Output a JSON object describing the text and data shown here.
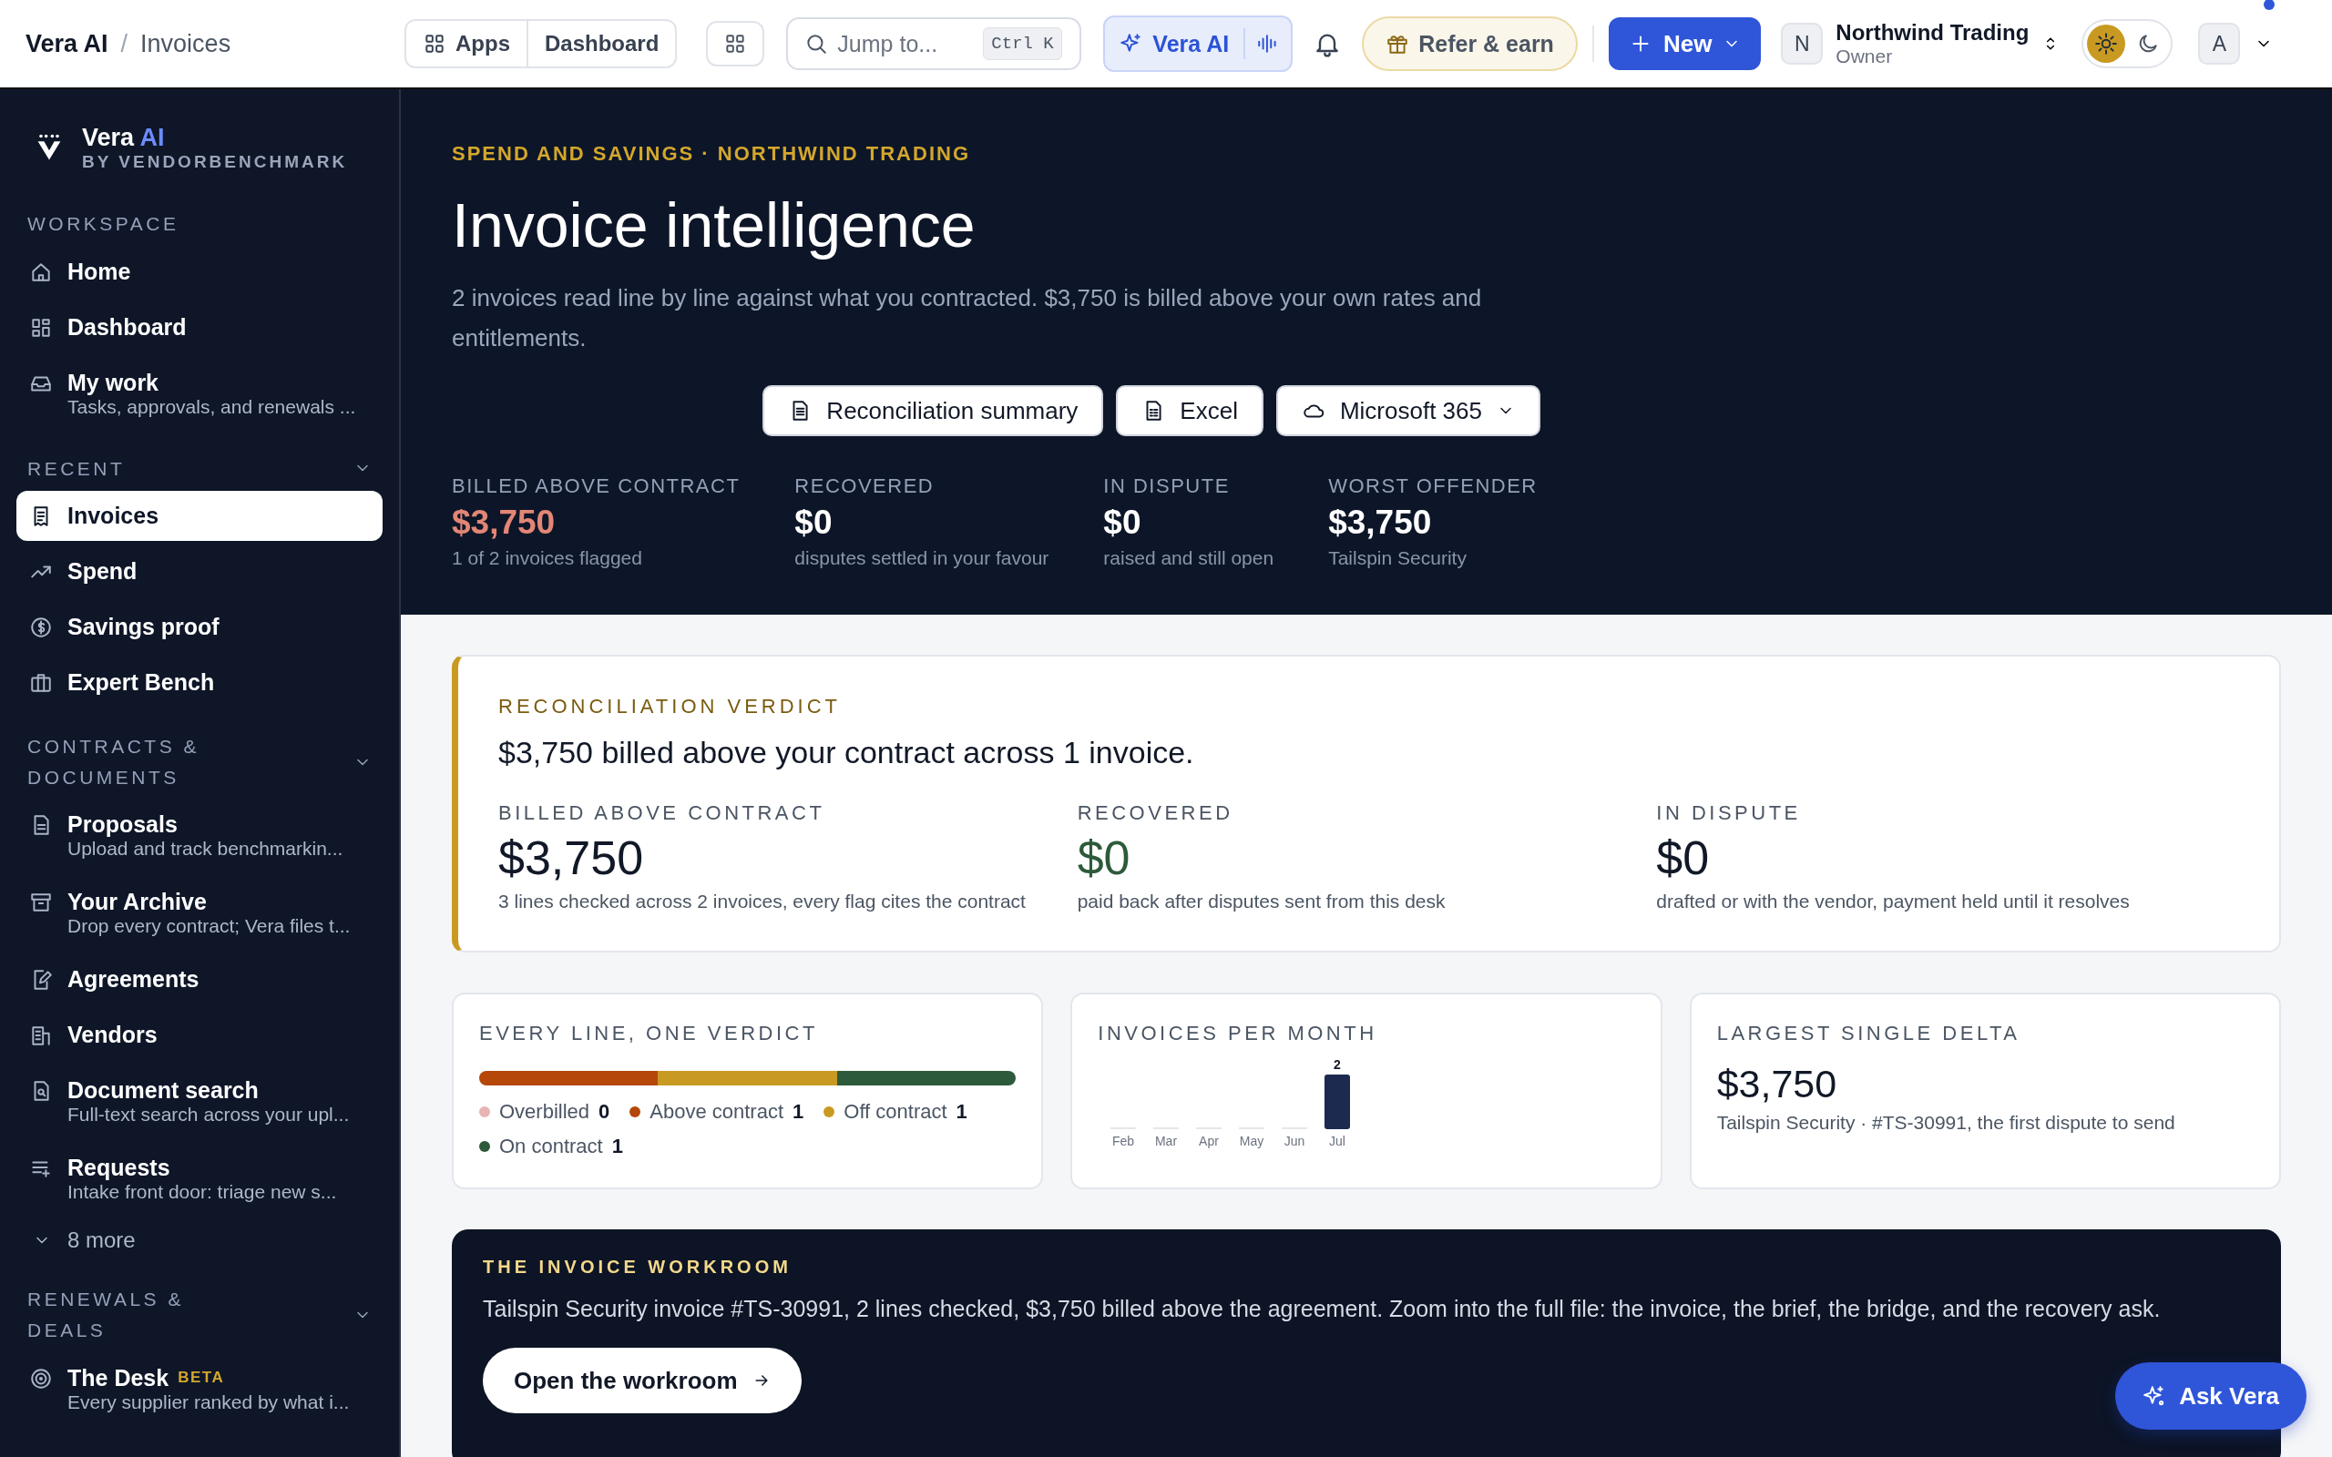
{
  "topbar": {
    "breadcrumb": {
      "items": [
        "Vera AI",
        "Invoices"
      ],
      "separator": "/"
    },
    "nav": [
      "Apps",
      "Dashboard"
    ],
    "search": {
      "placeholder": "Jump to...",
      "shortcut": "Ctrl K"
    },
    "assistant": "Vera AI",
    "refer": "Refer & earn",
    "new_button": "New",
    "org": {
      "initial": "N",
      "name": "Northwind Trading",
      "role": "Owner"
    },
    "theme": [
      {
        "kind": "light",
        "selected": true
      },
      {
        "kind": "dark",
        "selected": false
      }
    ],
    "user": {
      "initial": "A",
      "notification": true
    }
  },
  "sidebar": {
    "brand": {
      "name": "Vera",
      "accent": "AI",
      "by": "BY VENDORBENCHMARK"
    },
    "sections": [
      {
        "title": "WORKSPACE",
        "collapsible": false,
        "items": [
          {
            "label": "Home",
            "selected": false
          },
          {
            "label": "Dashboard",
            "selected": false
          },
          {
            "label": "My work",
            "sub": "Tasks, approvals, and renewals ...",
            "selected": false
          }
        ]
      },
      {
        "title": "RECENT",
        "collapsible": true,
        "items": [
          {
            "label": "Invoices",
            "selected": true
          },
          {
            "label": "Spend",
            "selected": false
          },
          {
            "label": "Savings proof",
            "selected": false
          },
          {
            "label": "Expert Bench",
            "selected": false
          }
        ]
      },
      {
        "title": "CONTRACTS & DOCUMENTS",
        "collapsible": true,
        "more": "8 more",
        "items": [
          {
            "label": "Proposals",
            "sub": "Upload and track benchmarkin...",
            "selected": false
          },
          {
            "label": "Your Archive",
            "sub": "Drop every contract; Vera files t...",
            "selected": false
          },
          {
            "label": "Agreements",
            "selected": false
          },
          {
            "label": "Vendors",
            "selected": false
          },
          {
            "label": "Document search",
            "sub": "Full-text search across your upl...",
            "selected": false
          },
          {
            "label": "Requests",
            "sub": "Intake front door: triage new s...",
            "selected": false
          }
        ]
      },
      {
        "title": "RENEWALS & DEALS",
        "collapsible": true,
        "items": [
          {
            "label": "The Desk",
            "badge": "BETA",
            "sub": "Every supplier ranked by what i...",
            "selected": false
          }
        ]
      }
    ]
  },
  "hero": {
    "eyebrow": "SPEND AND SAVINGS · NORTHWIND TRADING",
    "title": "Invoice intelligence",
    "description": "2 invoices read line by line against what you contracted. $3,750 is billed above your own rates and entitlements.",
    "actions": [
      {
        "label": "Reconciliation summary",
        "kind": "doc"
      },
      {
        "label": "Excel",
        "kind": "sheet"
      },
      {
        "label": "Microsoft 365",
        "kind": "cloud"
      }
    ],
    "stats": [
      {
        "label": "BILLED ABOVE CONTRACT",
        "value": "$3,750",
        "note": "1 of 2 invoices flagged",
        "color": "#e38676"
      },
      {
        "label": "RECOVERED",
        "value": "$0",
        "note": "disputes settled in your favour",
        "color": "#ffffff"
      },
      {
        "label": "IN DISPUTE",
        "value": "$0",
        "note": "raised and still open",
        "color": "#ffffff"
      },
      {
        "label": "WORST OFFENDER",
        "value": "$3,750",
        "note": "Tailspin Security",
        "color": "#ffffff"
      }
    ]
  },
  "verdict": {
    "eyebrow": "RECONCILIATION VERDICT",
    "headline": "$3,750 billed above your contract across 1 invoice.",
    "stats": [
      {
        "label": "BILLED ABOVE CONTRACT",
        "value": "$3,750",
        "note": "3 lines checked across 2 invoices, every flag cites the contract",
        "color": "#111827"
      },
      {
        "label": "RECOVERED",
        "value": "$0",
        "note": "paid back after disputes sent from this desk",
        "color": "#2d5a3a"
      },
      {
        "label": "IN DISPUTE",
        "value": "$0",
        "note": "drafted or with the vendor, payment held until it resolves",
        "color": "#111827"
      }
    ]
  },
  "line_verdict": {
    "title": "EVERY LINE, ONE VERDICT",
    "legend": [
      {
        "label": "Overbilled",
        "count": "0",
        "color": "#e8b4b4"
      },
      {
        "label": "Above contract",
        "count": "1",
        "color": "#b54708"
      },
      {
        "label": "Off contract",
        "count": "1",
        "color": "#c99a22"
      },
      {
        "label": "On contract",
        "count": "1",
        "color": "#2d5a3a"
      }
    ]
  },
  "invoices_per_month": {
    "title": "INVOICES PER MONTH",
    "chart_data": {
      "type": "bar",
      "categories": [
        "Feb",
        "Mar",
        "Apr",
        "May",
        "Jun",
        "Jul"
      ],
      "values": [
        0,
        0,
        0,
        0,
        0,
        2
      ],
      "value_labels": [
        null,
        null,
        null,
        null,
        null,
        "2"
      ]
    }
  },
  "largest_delta": {
    "title": "LARGEST SINGLE DELTA",
    "value": "$3,750",
    "note": "Tailspin Security · #TS-30991, the first dispute to send"
  },
  "workroom": {
    "eyebrow": "THE INVOICE WORKROOM",
    "text": "Tailspin Security invoice #TS-30991, 2 lines checked, $3,750 billed above the agreement. Zoom into the full file: the invoice, the brief, the bridge, and the recovery ask.",
    "button": "Open the workroom"
  },
  "ask": "Ask Vera"
}
